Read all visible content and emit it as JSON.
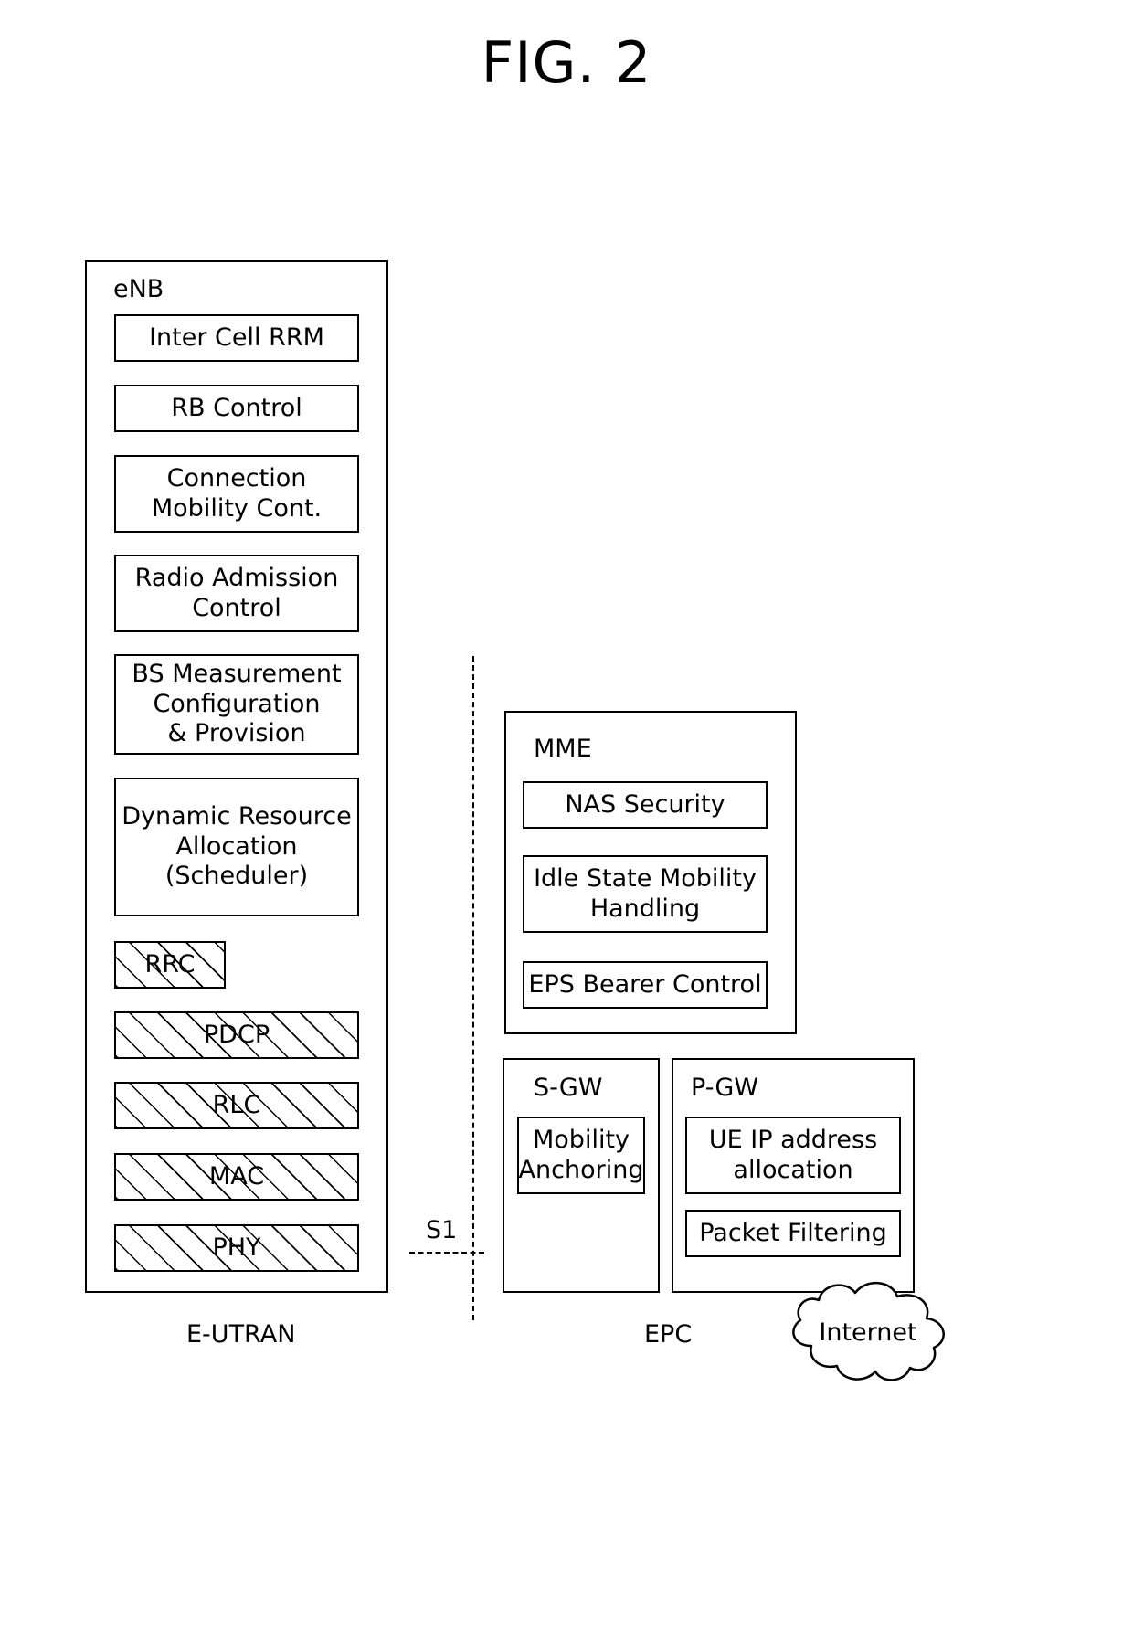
{
  "figure": {
    "title": "FIG. 2"
  },
  "enb": {
    "label": "eNB",
    "functions": [
      {
        "label": "Inter Cell RRM"
      },
      {
        "label": "RB Control"
      },
      {
        "label": "Connection\nMobility Cont."
      },
      {
        "label": "Radio Admission\nControl"
      },
      {
        "label": "BS Measurement\nConfiguration\n& Provision"
      },
      {
        "label": "Dynamic Resource\nAllocation\n(Scheduler)"
      }
    ],
    "protocol_stack": [
      {
        "label": "RRC"
      },
      {
        "label": "PDCP"
      },
      {
        "label": "RLC"
      },
      {
        "label": "MAC"
      },
      {
        "label": "PHY"
      }
    ]
  },
  "interface": {
    "s1_label": "S1"
  },
  "mme": {
    "label": "MME",
    "functions": [
      {
        "label": "NAS Security"
      },
      {
        "label": "Idle State Mobility\nHandling"
      },
      {
        "label": "EPS Bearer Control"
      }
    ]
  },
  "sgw": {
    "label": "S-GW",
    "functions": [
      {
        "label": "Mobility\nAnchoring"
      }
    ]
  },
  "pgw": {
    "label": "P-GW",
    "functions": [
      {
        "label": "UE IP address\nallocation"
      },
      {
        "label": "Packet Filtering"
      }
    ]
  },
  "internet": {
    "label": "Internet"
  },
  "domains": {
    "left": "E-UTRAN",
    "right": "EPC"
  },
  "colors": {
    "stroke": "#000000",
    "background": "#ffffff"
  }
}
